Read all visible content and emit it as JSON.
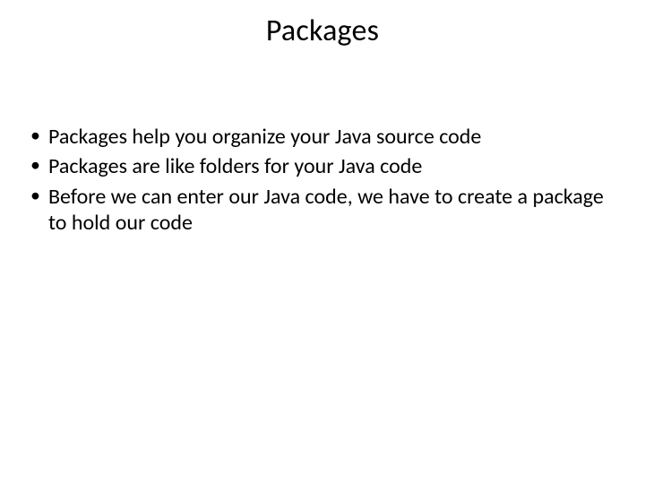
{
  "slide": {
    "title": "Packages",
    "bullets": [
      "Packages help you organize your Java source code",
      "Packages are like folders for your Java code",
      "Before we can enter our Java code, we have to create a package to hold our code"
    ]
  }
}
